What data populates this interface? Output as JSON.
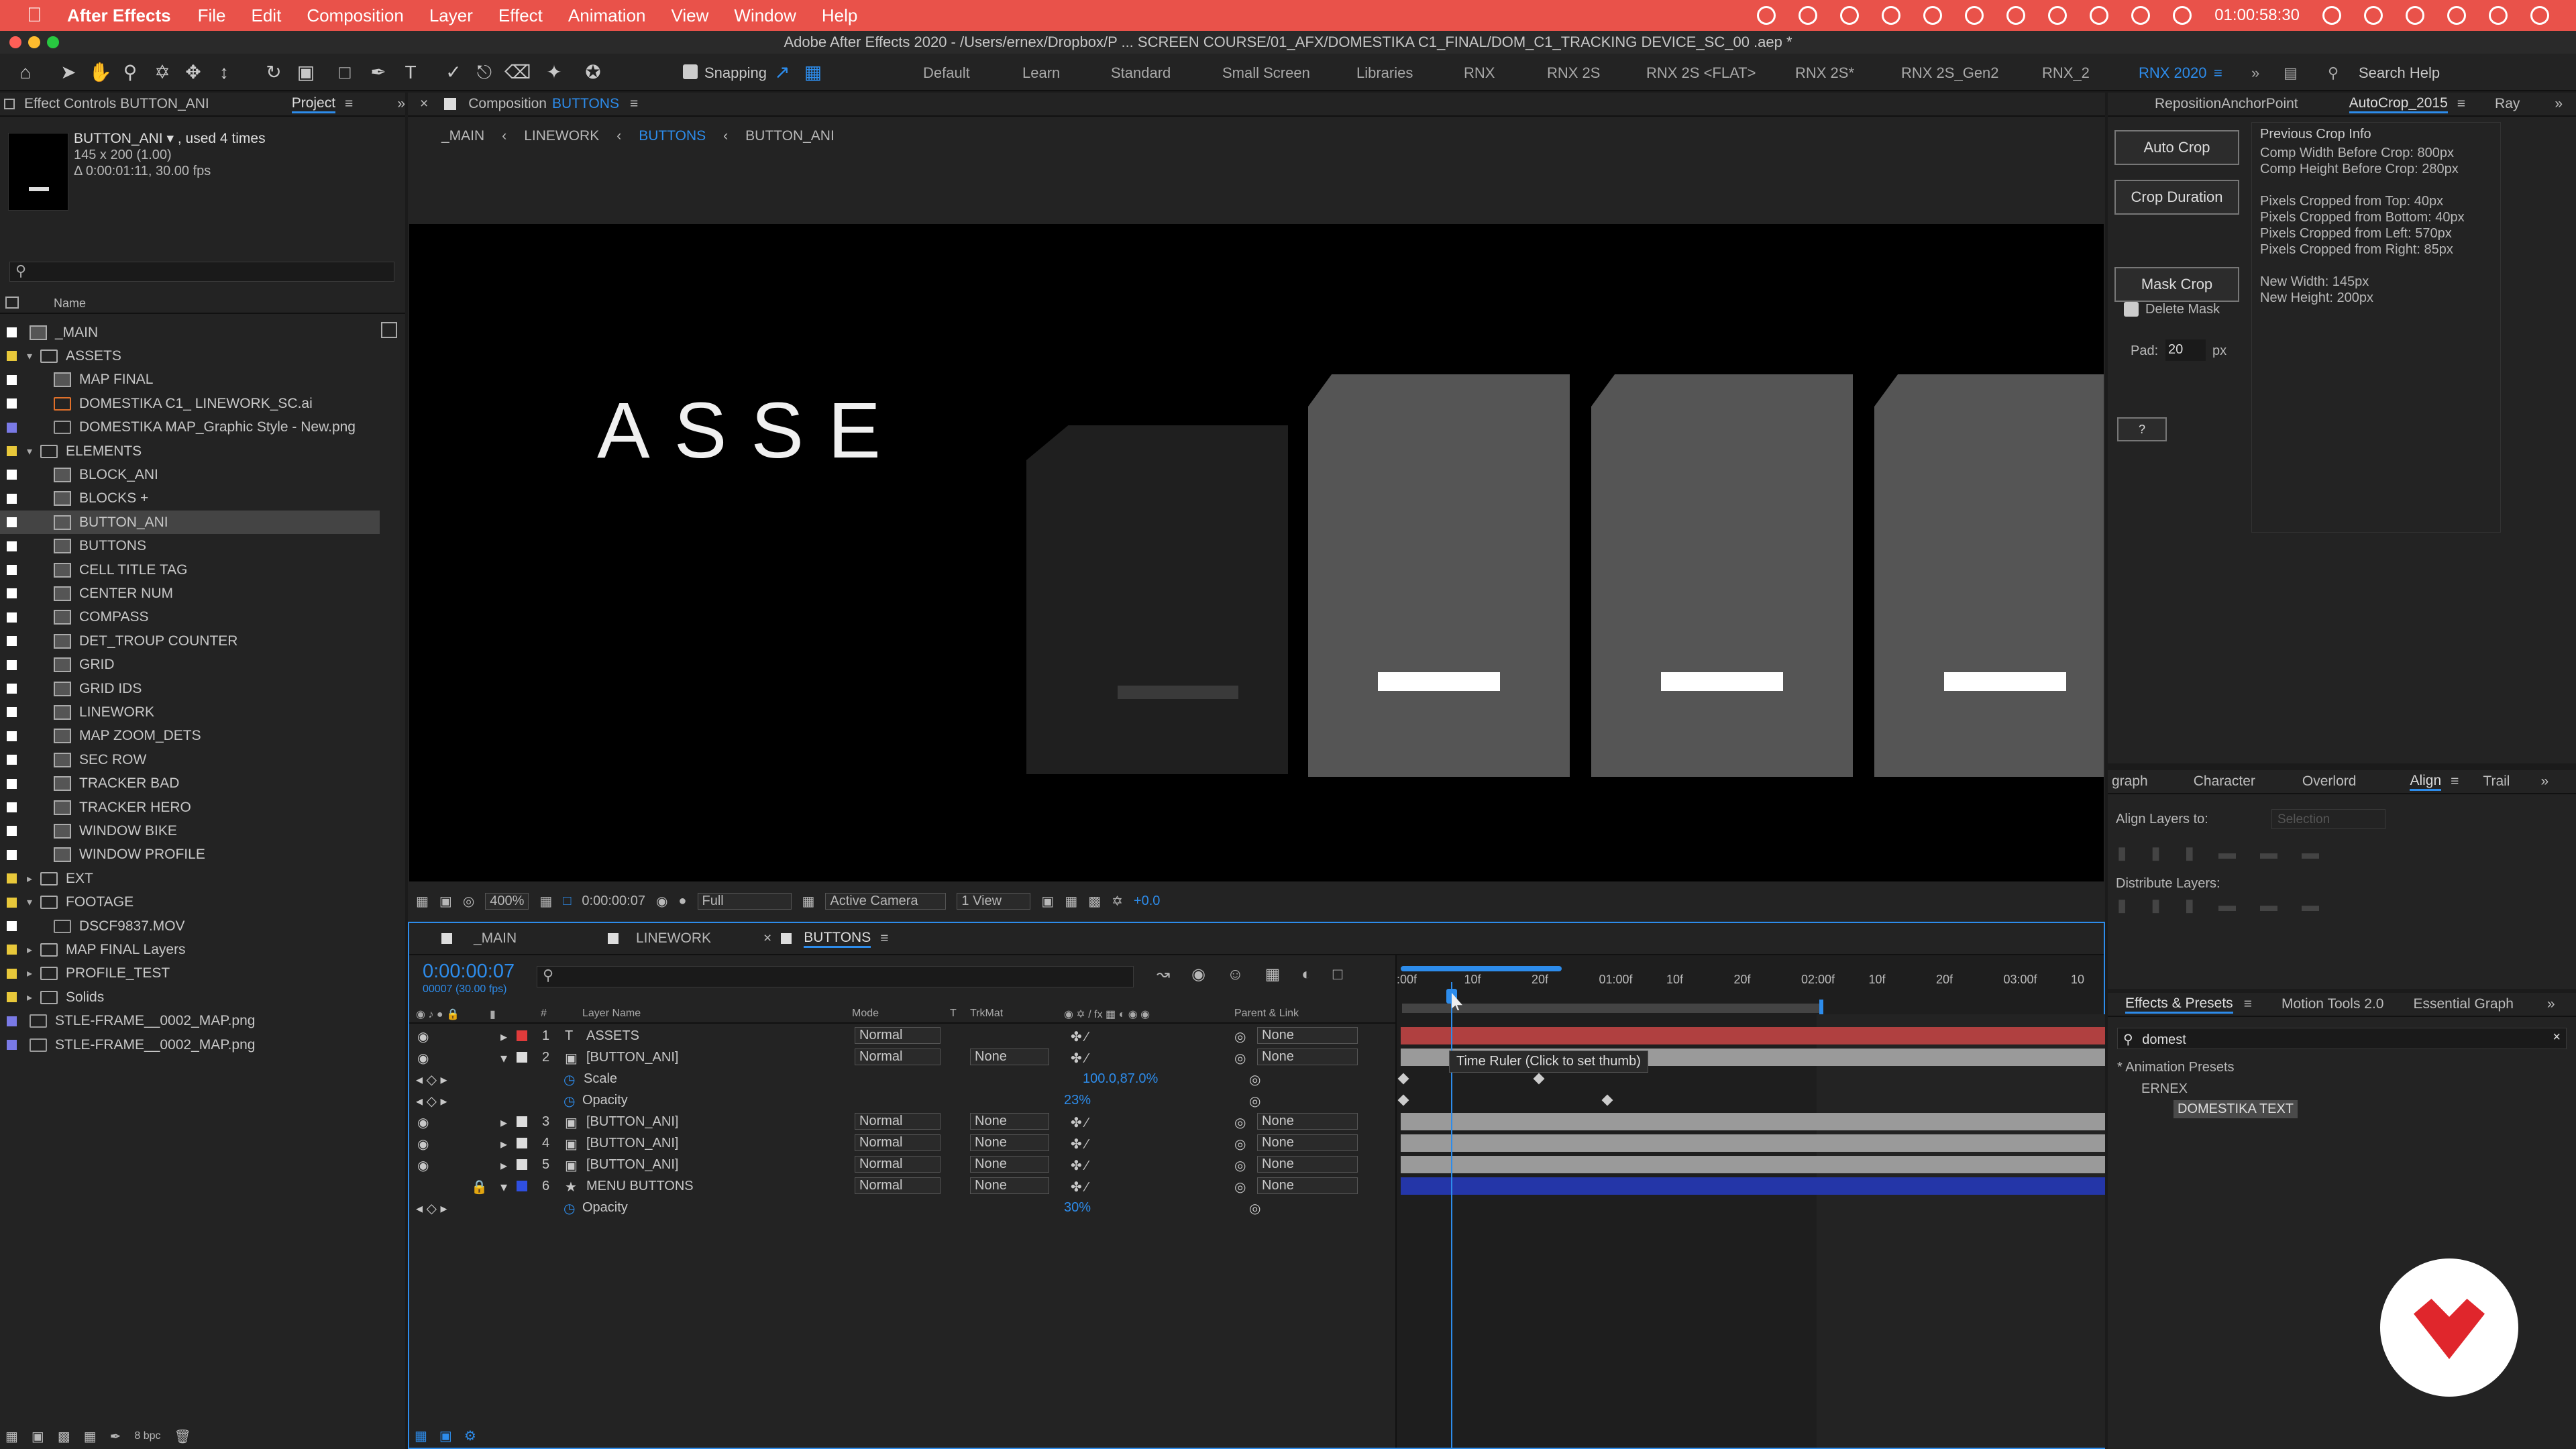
{
  "menubar": {
    "app": "After Effects",
    "items": [
      "File",
      "Edit",
      "Composition",
      "Layer",
      "Effect",
      "Animation",
      "View",
      "Window",
      "Help"
    ],
    "clock": "01:00:58:30"
  },
  "title": "Adobe After Effects 2020 - /Users/ernex/Dropbox/P ... SCREEN COURSE/01_AFX/DOMESTIKA C1_FINAL/DOM_C1_TRACKING DEVICE_SC_00 .aep *",
  "toolbar": {
    "snapping": "Snapping",
    "workspaces": [
      "Default",
      "Learn",
      "Standard",
      "Small Screen",
      "Libraries",
      "RNX",
      "RNX 2S",
      "RNX 2S <FLAT>",
      "RNX 2S*",
      "RNX 2S_Gen2",
      "RNX_2",
      "RNX 2020"
    ],
    "search": "Search Help"
  },
  "project": {
    "tab_effect": "Effect Controls BUTTON_ANI",
    "tab_project": "Project",
    "item_name": "BUTTON_ANI ▾ , used 4 times",
    "item_dims": "145 x 200 (1.00)",
    "item_dur": "Δ 0:00:01:11, 30.00 fps",
    "col_name": "Name",
    "depth": "8 bpc",
    "items": [
      {
        "name": "_MAIN",
        "type": "comp",
        "indent": 0,
        "color": "#ffffff"
      },
      {
        "name": "ASSETS",
        "type": "folder",
        "indent": 0,
        "open": true,
        "color": "#e8c83a"
      },
      {
        "name": "MAP FINAL",
        "type": "comp",
        "indent": 1,
        "color": "#ffffff"
      },
      {
        "name": "DOMESTIKA C1_ LINEWORK_SC.ai",
        "type": "ai",
        "indent": 1,
        "color": "#ffffff"
      },
      {
        "name": "DOMESTIKA MAP_Graphic Style - New.png",
        "type": "file",
        "indent": 1,
        "color": "#7a7ae6"
      },
      {
        "name": "ELEMENTS",
        "type": "folder",
        "indent": 0,
        "open": true,
        "color": "#e8c83a"
      },
      {
        "name": "BLOCK_ANI",
        "type": "comp",
        "indent": 1,
        "color": "#ffffff"
      },
      {
        "name": "BLOCKS +",
        "type": "comp",
        "indent": 1,
        "color": "#ffffff"
      },
      {
        "name": "BUTTON_ANI",
        "type": "comp",
        "indent": 1,
        "color": "#ffffff",
        "selected": true
      },
      {
        "name": "BUTTONS",
        "type": "comp",
        "indent": 1,
        "color": "#ffffff"
      },
      {
        "name": "CELL TITLE TAG",
        "type": "comp",
        "indent": 1,
        "color": "#ffffff"
      },
      {
        "name": "CENTER NUM",
        "type": "comp",
        "indent": 1,
        "color": "#ffffff"
      },
      {
        "name": "COMPASS",
        "type": "comp",
        "indent": 1,
        "color": "#ffffff"
      },
      {
        "name": "DET_TROUP COUNTER",
        "type": "comp",
        "indent": 1,
        "color": "#ffffff"
      },
      {
        "name": "GRID",
        "type": "comp",
        "indent": 1,
        "color": "#ffffff"
      },
      {
        "name": "GRID IDS",
        "type": "comp",
        "indent": 1,
        "color": "#ffffff"
      },
      {
        "name": "LINEWORK",
        "type": "comp",
        "indent": 1,
        "color": "#ffffff"
      },
      {
        "name": "MAP ZOOM_DETS",
        "type": "comp",
        "indent": 1,
        "color": "#ffffff"
      },
      {
        "name": "SEC ROW",
        "type": "comp",
        "indent": 1,
        "color": "#ffffff"
      },
      {
        "name": "TRACKER BAD",
        "type": "comp",
        "indent": 1,
        "color": "#ffffff"
      },
      {
        "name": "TRACKER HERO",
        "type": "comp",
        "indent": 1,
        "color": "#ffffff"
      },
      {
        "name": "WINDOW BIKE",
        "type": "comp",
        "indent": 1,
        "color": "#ffffff"
      },
      {
        "name": "WINDOW PROFILE",
        "type": "comp",
        "indent": 1,
        "color": "#ffffff"
      },
      {
        "name": "EXT",
        "type": "folder",
        "indent": 0,
        "open": false,
        "color": "#e8c83a"
      },
      {
        "name": "FOOTAGE",
        "type": "folder",
        "indent": 0,
        "open": true,
        "color": "#e8c83a"
      },
      {
        "name": "DSCF9837.MOV",
        "type": "file",
        "indent": 1,
        "color": "#ffffff"
      },
      {
        "name": "MAP FINAL Layers",
        "type": "folder",
        "indent": 0,
        "open": false,
        "color": "#e8c83a"
      },
      {
        "name": "PROFILE_TEST",
        "type": "folder",
        "indent": 0,
        "open": false,
        "color": "#e8c83a"
      },
      {
        "name": "Solids",
        "type": "folder",
        "indent": 0,
        "open": false,
        "color": "#e8c83a"
      },
      {
        "name": "STLE-FRAME__0002_MAP.png",
        "type": "file",
        "indent": 0,
        "color": "#7a7ae6"
      },
      {
        "name": "STLE-FRAME__0002_MAP.png",
        "type": "file",
        "indent": 0,
        "color": "#7a7ae6"
      }
    ]
  },
  "comp": {
    "tab": "Composition",
    "tab_name": "BUTTONS",
    "breadcrumbs": [
      "_MAIN",
      "LINEWORK",
      "BUTTONS",
      "BUTTON_ANI"
    ],
    "viewer_text": "ASSE",
    "zoom": "400%",
    "timecode": "0:00:00:07",
    "resolution": "Full",
    "camera": "Active Camera",
    "views": "1 View",
    "exposure": "+0.0"
  },
  "timeline": {
    "tabs": [
      "_MAIN",
      "LINEWORK",
      "BUTTONS"
    ],
    "timecode": "0:00:00:07",
    "fps": "00007 (30.00 fps)",
    "col_layer": "Layer Name",
    "col_mode": "Mode",
    "col_t": "T",
    "col_trkmat": "TrkMat",
    "col_parent": "Parent & Link",
    "col_num": "#",
    "ticks": [
      ":00f",
      "10f",
      "20f",
      "01:00f",
      "10f",
      "20f",
      "02:00f",
      "10f",
      "20f",
      "03:00f",
      "10"
    ],
    "tooltip": "Time Ruler (Click to set thumb)",
    "layers": [
      {
        "num": "1",
        "name": "ASSETS",
        "mode": "Normal",
        "trkmat": "",
        "parent": "None",
        "color": "#e03b3b",
        "bar": "#b04040",
        "type": "text"
      },
      {
        "num": "2",
        "name": "[BUTTON_ANI]",
        "mode": "Normal",
        "trkmat": "None",
        "parent": "None",
        "color": "#dddddd",
        "bar": "#9a9a9a",
        "type": "comp",
        "open": true
      },
      {
        "prop": "Scale",
        "value": "100.0,87.0%"
      },
      {
        "prop": "Opacity",
        "value": "23%"
      },
      {
        "num": "3",
        "name": "[BUTTON_ANI]",
        "mode": "Normal",
        "trkmat": "None",
        "parent": "None",
        "color": "#dddddd",
        "bar": "#9a9a9a",
        "type": "comp"
      },
      {
        "num": "4",
        "name": "[BUTTON_ANI]",
        "mode": "Normal",
        "trkmat": "None",
        "parent": "None",
        "color": "#dddddd",
        "bar": "#9a9a9a",
        "type": "comp"
      },
      {
        "num": "5",
        "name": "[BUTTON_ANI]",
        "mode": "Normal",
        "trkmat": "None",
        "parent": "None",
        "color": "#dddddd",
        "bar": "#9a9a9a",
        "type": "comp"
      },
      {
        "num": "6",
        "name": "MENU BUTTONS",
        "mode": "Normal",
        "trkmat": "None",
        "parent": "None",
        "color": "#2f4fe0",
        "bar": "#2436a8",
        "type": "shape"
      },
      {
        "prop": "Opacity",
        "value": "30%"
      }
    ]
  },
  "autocrop": {
    "tabs": [
      "RepositionAnchorPoint",
      "AutoCrop_2015",
      "Ray"
    ],
    "auto_crop": "Auto Crop",
    "crop_duration": "Crop Duration",
    "mask_crop": "Mask Crop",
    "delete_mask": "Delete Mask",
    "pad_label": "Pad:",
    "pad_value": "20",
    "pad_unit": "px",
    "help": "?",
    "info_title": "Previous Crop Info",
    "info": [
      "Comp Width Before Crop: 800px",
      "Comp Height Before Crop: 280px",
      "",
      "Pixels Cropped from Top: 40px",
      "Pixels Cropped from Bottom: 40px",
      "Pixels Cropped from Left: 570px",
      "Pixels Cropped from Right: 85px",
      "",
      "New Width: 145px",
      "New Height: 200px"
    ]
  },
  "align": {
    "tabs": [
      "graph",
      "Character",
      "Overlord",
      "Align",
      "Trail"
    ],
    "align_to": "Align Layers to:",
    "selection": "Selection",
    "distribute": "Distribute Layers:"
  },
  "effects": {
    "tabs": [
      "Effects & Presets",
      "Motion Tools 2.0",
      "Essential Graph"
    ],
    "search": "domest",
    "tree": [
      "* Animation Presets",
      "ERNEX",
      "DOMESTIKA TEXT"
    ]
  },
  "colors": {
    "accent": "#2d8ceb",
    "menubar": "#e9524a",
    "logo": "#e0262c"
  }
}
